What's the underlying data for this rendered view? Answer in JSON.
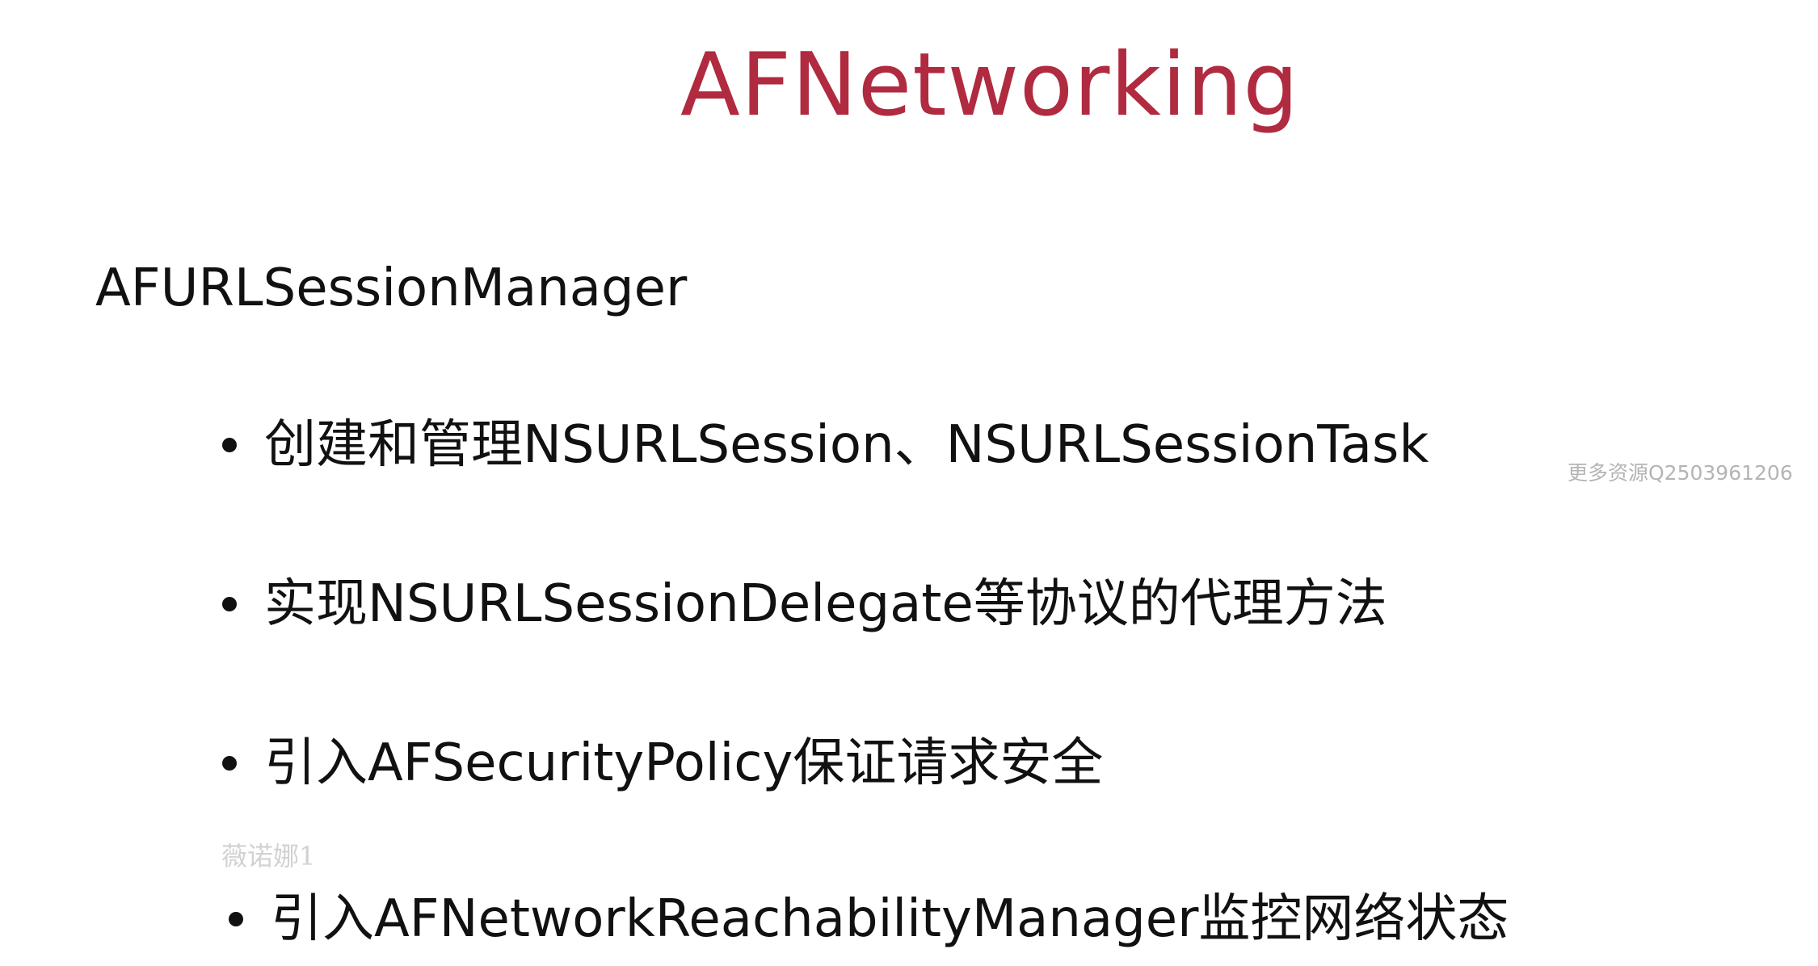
{
  "slide": {
    "title": "AFNetworking",
    "title_color": "#b02a40",
    "heading": "AFURLSessionManager",
    "bullets": [
      "创建和管理NSURLSession、NSURLSessionTask",
      "实现NSURLSessionDelegate等协议的代理方法",
      "引入AFSecurityPolicy保证请求安全",
      "引入AFNetworkReachabilityManager监控网络状态"
    ]
  },
  "overlays": {
    "watermark_right": "更多资源Q2503961206",
    "watermark_left": "薇诺娜1"
  }
}
